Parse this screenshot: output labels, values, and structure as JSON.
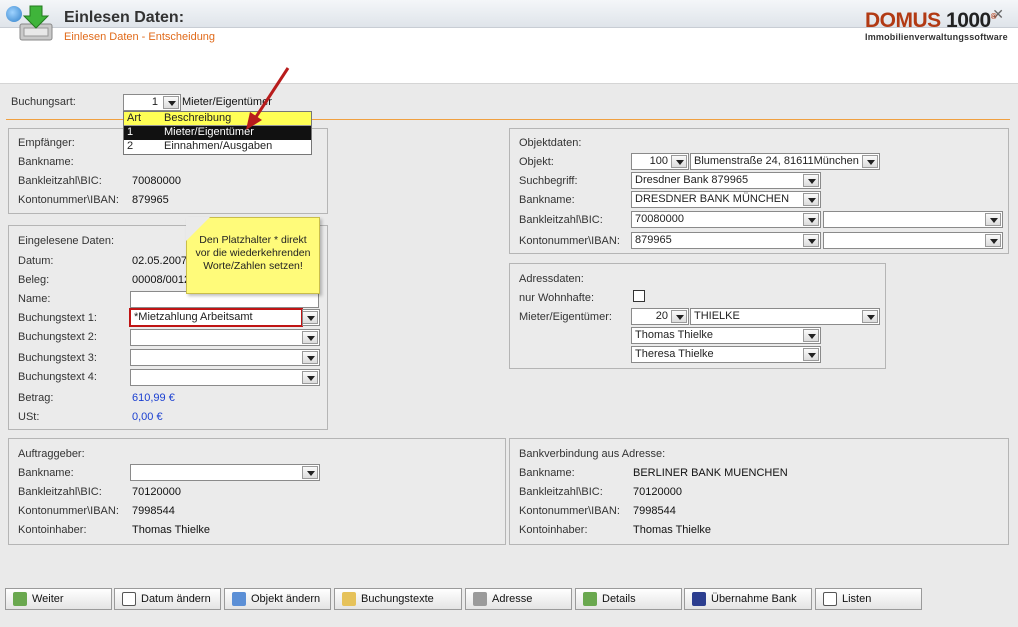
{
  "header": {
    "title": "Einlesen Daten:",
    "subtitle": "Einlesen Daten - Entscheidung",
    "logo_main": "DOMUS",
    "logo_num": "1000",
    "logo_sub": "Immobilienverwaltungssoftware"
  },
  "buchungsart": {
    "label": "Buchungsart:",
    "code": "1",
    "text": "Mieter/Eigentümer",
    "dropdown": {
      "col1": "Art",
      "col2": "Beschreibung",
      "options": [
        {
          "code": "1",
          "text": "Mieter/Eigentümer"
        },
        {
          "code": "2",
          "text": "Einnahmen/Ausgaben"
        }
      ]
    }
  },
  "empfaenger": {
    "title": "Empfänger:",
    "bankname_label": "Bankname:",
    "blz_label": "Bankleitzahl\\BIC:",
    "blz": "70080000",
    "konto_label": "Kontonummer\\IBAN:",
    "konto": "879965"
  },
  "eingelesen": {
    "title": "Eingelesene Daten:",
    "datum_label": "Datum:",
    "datum": "02.05.2007",
    "beleg_label": "Beleg:",
    "beleg": "00008/0012",
    "name_label": "Name:",
    "name": "",
    "bt1_label": "Buchungstext 1:",
    "bt1": "*Mietzahlung Arbeitsamt",
    "bt2_label": "Buchungstext 2:",
    "bt3_label": "Buchungstext 3:",
    "bt4_label": "Buchungstext 4:",
    "betrag_label": "Betrag:",
    "betrag": "610,99 €",
    "ust_label": "USt:",
    "ust": "0,00 €"
  },
  "tooltip": {
    "text1": "Den Platzhalter * direkt",
    "text2": "vor die wiederkehrenden",
    "text3": "Worte/Zahlen setzen!"
  },
  "objektdaten": {
    "title": "Objektdaten:",
    "objekt_label": "Objekt:",
    "objekt_nr": "100",
    "objekt_adresse": "Blumenstraße 24, 81611München",
    "such_label": "Suchbegriff:",
    "such": "Dresdner Bank 879965",
    "bankname_label": "Bankname:",
    "bankname": "DRESDNER BANK MÜNCHEN",
    "blz_label": "Bankleitzahl\\BIC:",
    "blz": "70080000",
    "konto_label": "Kontonummer\\IBAN:",
    "konto": "879965"
  },
  "adressdaten": {
    "title": "Adressdaten:",
    "wohnhaft_label": "nur Wohnhafte:",
    "mieter_label": "Mieter/Eigentümer:",
    "mieter_nr": "20",
    "mieter_name": "THIELKE",
    "person1": "Thomas Thielke",
    "person2": "Theresa Thielke"
  },
  "auftraggeber": {
    "title": "Auftraggeber:",
    "bankname_label": "Bankname:",
    "blz_label": "Bankleitzahl\\BIC:",
    "blz": "70120000",
    "konto_label": "Kontonummer\\IBAN:",
    "konto": "7998544",
    "inhaber_label": "Kontoinhaber:",
    "inhaber": "Thomas Thielke"
  },
  "bankverbindung": {
    "title": "Bankverbindung aus Adresse:",
    "bankname_label": "Bankname:",
    "bankname": "BERLINER BANK MUENCHEN",
    "blz_label": "Bankleitzahl\\BIC:",
    "blz": "70120000",
    "konto_label": "Kontonummer\\IBAN:",
    "konto": "7998544",
    "inhaber_label": "Kontoinhaber:",
    "inhaber": "Thomas Thielke"
  },
  "buttons": {
    "weiter": "Weiter",
    "datum": "Datum ändern",
    "objekt": "Objekt ändern",
    "buchungstexte": "Buchungstexte",
    "adresse": "Adresse",
    "details": "Details",
    "uebernahme": "Übernahme Bank",
    "listen": "Listen"
  },
  "colors": {
    "accent_orange": "#e06a1a",
    "logo_red": "#b23a14",
    "amount_blue": "#1a3fd1",
    "highlight_red": "#c01414",
    "tooltip_yellow": "#fffb7a"
  }
}
